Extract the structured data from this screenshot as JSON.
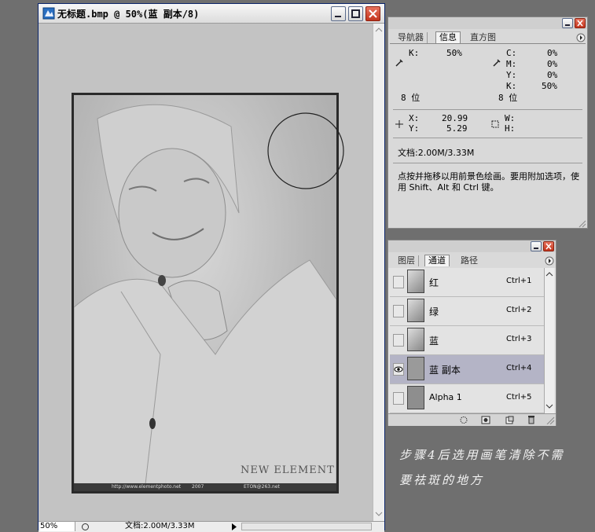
{
  "document": {
    "title": "无标题.bmp @ 50%(蓝 副本/8)",
    "zoom": "50%",
    "doc_size": "文档:2.00M/3.33M",
    "watermark_brand": "NEW ELEMENT",
    "watermark_url": "http://www.elementphoto.net",
    "watermark_year": "2007",
    "watermark_email": "ETON@263.net"
  },
  "info_panel": {
    "tabs": [
      "导航器",
      "信息",
      "直方图"
    ],
    "active_tab": "信息",
    "k_label": "K:",
    "k_value": "50%",
    "cmyk": [
      {
        "label": "C:",
        "value": "0%"
      },
      {
        "label": "M:",
        "value": "0%"
      },
      {
        "label": "Y:",
        "value": "0%"
      },
      {
        "label": "K:",
        "value": "50%"
      }
    ],
    "bit_left": "8 位",
    "bit_right": "8 位",
    "x_label": "X:",
    "x_value": "20.99",
    "y_label": "Y:",
    "y_value": "5.29",
    "w_label": "W:",
    "h_label": "H:",
    "doc_size": "文档:2.00M/3.33M",
    "hint": "点按并拖移以用前景色绘画。要用附加选项，使用 Shift、Alt 和 Ctrl 键。"
  },
  "channels_panel": {
    "tabs": [
      "图层",
      "通道",
      "路径"
    ],
    "active_tab": "通道",
    "channels": [
      {
        "name": "红",
        "shortcut": "Ctrl+1"
      },
      {
        "name": "绿",
        "shortcut": "Ctrl+2"
      },
      {
        "name": "蓝",
        "shortcut": "Ctrl+3"
      },
      {
        "name": "蓝 副本",
        "shortcut": "Ctrl+4"
      },
      {
        "name": "Alpha 1",
        "shortcut": "Ctrl+5"
      }
    ]
  },
  "caption": {
    "line1": "步骤4后选用画笔清除不需",
    "line2": "要祛斑的地方"
  }
}
